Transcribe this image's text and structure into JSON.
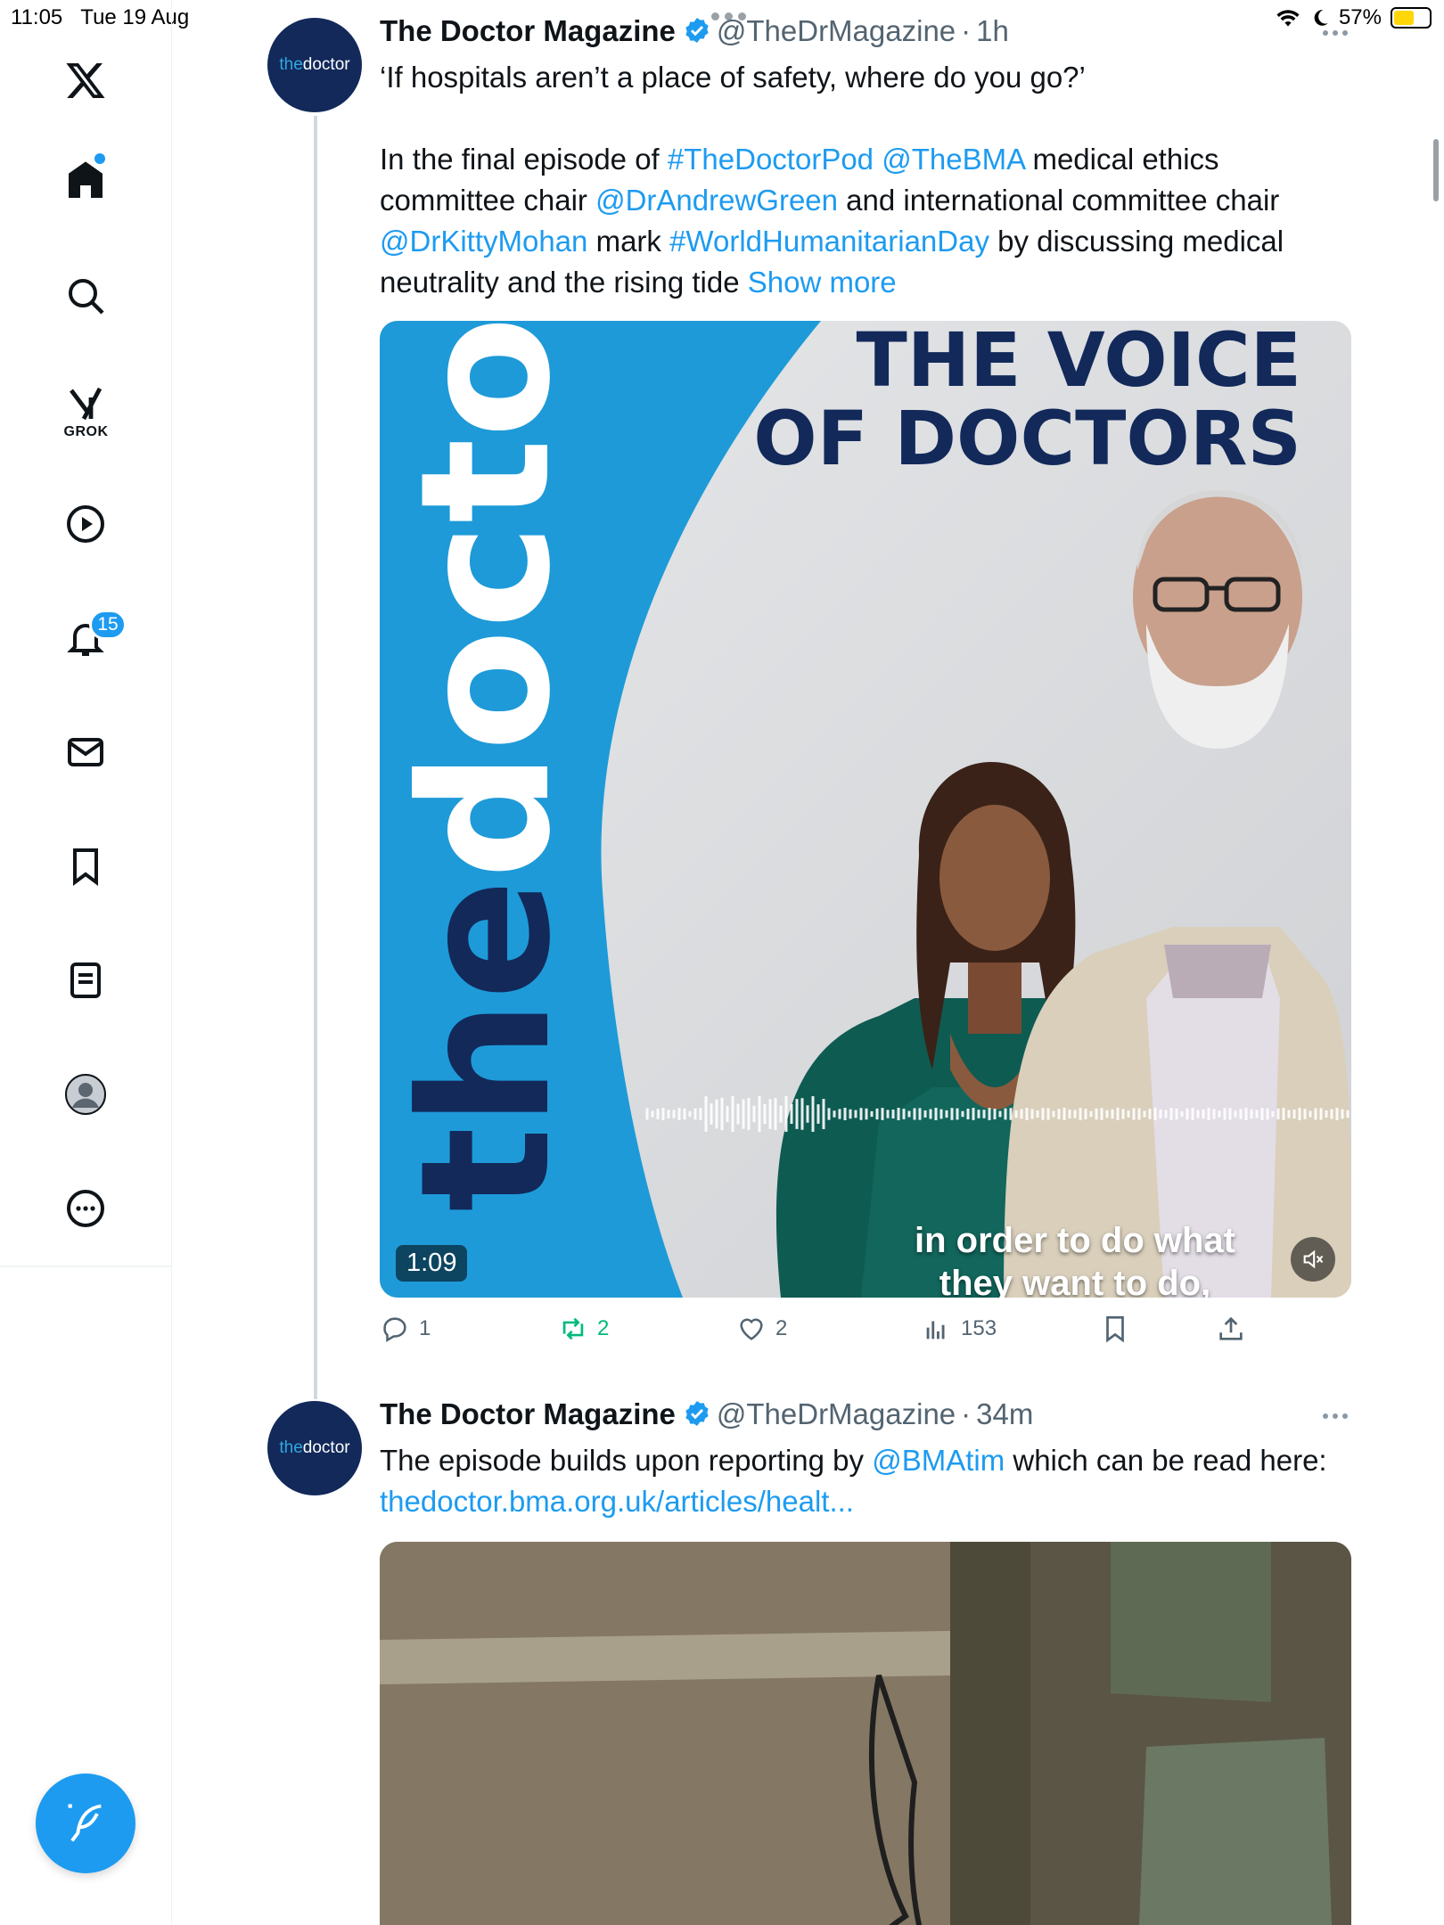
{
  "status_bar": {
    "time": "11:05",
    "date": "Tue 19 Aug",
    "battery": "57%",
    "battery_level": 0.57
  },
  "sidebar": {
    "items": [
      {
        "name": "x-logo-icon"
      },
      {
        "name": "home-icon"
      },
      {
        "name": "search-icon"
      },
      {
        "name": "grok-icon",
        "label": "GROK"
      },
      {
        "name": "video-icon"
      },
      {
        "name": "notifications-icon",
        "badge": "15"
      },
      {
        "name": "messages-icon"
      },
      {
        "name": "bookmarks-icon"
      },
      {
        "name": "lists-icon"
      },
      {
        "name": "profile-icon"
      },
      {
        "name": "more-icon"
      }
    ],
    "compose": "compose-icon"
  },
  "tweets": [
    {
      "avatar_text_the": "the",
      "avatar_text_doctor": "doctor",
      "name": "The Doctor Magazine",
      "handle": "@TheDrMagazine",
      "separator": "·",
      "time": "1h",
      "line1": "‘If hospitals aren’t a place of safety, where do you go?’",
      "para_parts": {
        "a": "In the final episode of ",
        "b": "#TheDoctorPod",
        "c": " ",
        "d": "@TheBMA",
        "e": " medical ethics committee chair ",
        "f": "@DrAndrewGreen",
        "g": " and international committee chair ",
        "h": "@DrKittyMohan",
        "i": " mark ",
        "j": "#WorldHumanitarianDay",
        "k": " by discussing medical neutrality and the rising tide ",
        "l": "Show more"
      },
      "media": {
        "headline_line1": "THE VOICE",
        "headline_line2": "OF DOCTORS",
        "vertical_brand_the": "the",
        "vertical_brand_doctor": "doctor",
        "caption_line1": "in order to do what",
        "caption_line2": "they want to do,",
        "duration": "1:09"
      },
      "actions": {
        "replies": "1",
        "retweets": "2",
        "likes": "2",
        "views": "153"
      }
    },
    {
      "avatar_text_the": "the",
      "avatar_text_doctor": "doctor",
      "name": "The Doctor Magazine",
      "handle": "@TheDrMagazine",
      "separator": "·",
      "time": "34m",
      "parts": {
        "a": "The episode builds upon reporting by ",
        "b": "@BMAtim",
        "c": " which can be read here: ",
        "d": "thedoctor.bma.org.uk/articles/healt..."
      }
    }
  ],
  "colors": {
    "accent": "#1d9bf0",
    "navy": "#12295a",
    "brand_blue": "#1e9ad8",
    "retweet_green": "#00ba7c"
  }
}
